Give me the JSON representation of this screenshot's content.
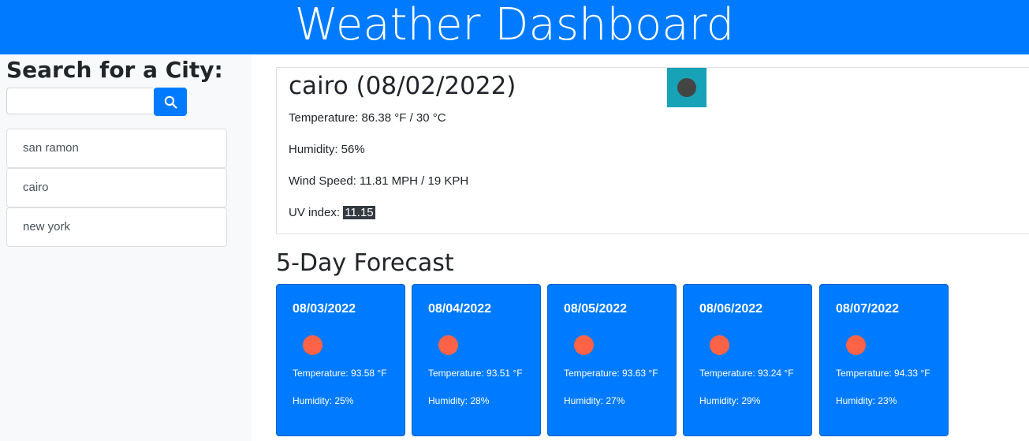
{
  "header": {
    "title": "Weather Dashboard"
  },
  "sidebar": {
    "search_title": "Search for a City:",
    "search_input": {
      "value": "",
      "placeholder": ""
    },
    "history": [
      {
        "label": "san ramon"
      },
      {
        "label": "cairo"
      },
      {
        "label": "new york"
      }
    ]
  },
  "current": {
    "title": "cairo (08/02/2022)",
    "temperature": "Temperature: 86.38 °F / 30 °C",
    "humidity": "Humidity: 56%",
    "wind": "Wind Speed: 11.81 MPH / 19 KPH",
    "uv_label": "UV index: ",
    "uv_value": "11.15",
    "icon": "weather-icon"
  },
  "forecast": {
    "title": "5-Day Forecast",
    "days": [
      {
        "date": "08/03/2022",
        "temp": "Temperature: 93.58 °F",
        "humidity": "Humidity: 25%",
        "icon": "sun-icon"
      },
      {
        "date": "08/04/2022",
        "temp": "Temperature: 93.51 °F",
        "humidity": "Humidity: 28%",
        "icon": "sun-icon"
      },
      {
        "date": "08/05/2022",
        "temp": "Temperature: 93.63 °F",
        "humidity": "Humidity: 27%",
        "icon": "sun-icon"
      },
      {
        "date": "08/06/2022",
        "temp": "Temperature: 93.24 °F",
        "humidity": "Humidity: 29%",
        "icon": "sun-icon"
      },
      {
        "date": "08/07/2022",
        "temp": "Temperature: 94.33 °F",
        "humidity": "Humidity: 23%",
        "icon": "sun-icon"
      }
    ]
  },
  "colors": {
    "primary": "#007bff",
    "sidebar_bg": "#f8f9fa",
    "current_icon_bg": "#17a2b8",
    "sun": "#ff6347",
    "uv_badge": "#343a40"
  }
}
